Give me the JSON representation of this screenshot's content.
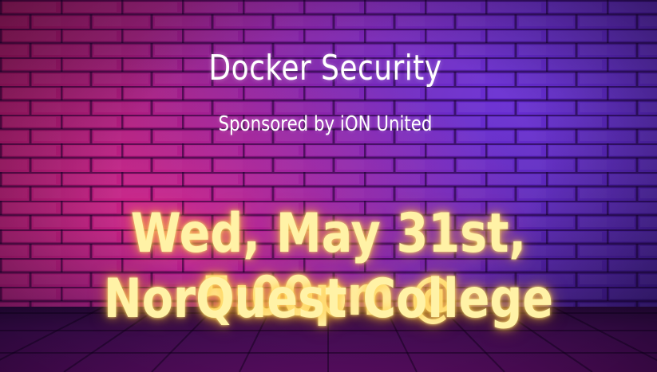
{
  "title": "Docker Security",
  "subtitle": "Sponsored by iON United",
  "event": {
    "line1": "Wed, May 31st, 5:00pm @",
    "line2": "NorQuest College"
  },
  "colors": {
    "title_text": "#ffffff",
    "event_text": "#fff2a6",
    "event_glow": "#ffc83c",
    "background_pink": "#b1165f",
    "background_purple": "#5a1fa8"
  }
}
